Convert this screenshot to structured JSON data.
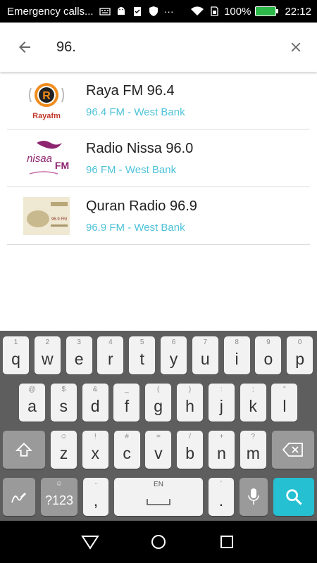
{
  "status_bar": {
    "carrier": "Emergency calls...",
    "battery": "100%",
    "time": "22:12"
  },
  "search": {
    "query": "96."
  },
  "results": [
    {
      "title": "Raya FM 96.4",
      "subtitle": "96.4 FM - West Bank",
      "logo_text": "Rayafm"
    },
    {
      "title": "Radio Nissa 96.0",
      "subtitle": "96 FM - West Bank",
      "logo_text": "nisaa",
      "logo_suffix": "FM"
    },
    {
      "title": "Quran Radio 96.9",
      "subtitle": "96.9 FM - West Bank",
      "logo_text": "96.9 FM"
    }
  ],
  "keyboard": {
    "row1": [
      {
        "k": "q",
        "h": "1"
      },
      {
        "k": "w",
        "h": "2"
      },
      {
        "k": "e",
        "h": "3"
      },
      {
        "k": "r",
        "h": "4"
      },
      {
        "k": "t",
        "h": "5"
      },
      {
        "k": "y",
        "h": "6"
      },
      {
        "k": "u",
        "h": "7"
      },
      {
        "k": "i",
        "h": "8"
      },
      {
        "k": "o",
        "h": "9"
      },
      {
        "k": "p",
        "h": "0"
      }
    ],
    "row2": [
      {
        "k": "a",
        "h": "@"
      },
      {
        "k": "s",
        "h": "$"
      },
      {
        "k": "d",
        "h": "&"
      },
      {
        "k": "f",
        "h": "_"
      },
      {
        "k": "g",
        "h": "("
      },
      {
        "k": "h",
        "h": ")"
      },
      {
        "k": "j",
        "h": ":"
      },
      {
        "k": "k",
        "h": ";"
      },
      {
        "k": "l",
        "h": "\""
      }
    ],
    "row3": [
      {
        "k": "z",
        "h": "☺"
      },
      {
        "k": "x",
        "h": "!"
      },
      {
        "k": "c",
        "h": "#"
      },
      {
        "k": "v",
        "h": "="
      },
      {
        "k": "b",
        "h": "/"
      },
      {
        "k": "n",
        "h": "+"
      },
      {
        "k": "m",
        "h": "?"
      }
    ],
    "symbols_label": "?123",
    "comma": ",",
    "comma_hint": "-",
    "period": ".",
    "period_hint": "'",
    "space_lang": "EN"
  },
  "colors": {
    "accent": "#4fc3d9",
    "search_key": "#25c0d1",
    "keyboard_bg": "#5e5e5e",
    "battery": "#2db84a"
  }
}
